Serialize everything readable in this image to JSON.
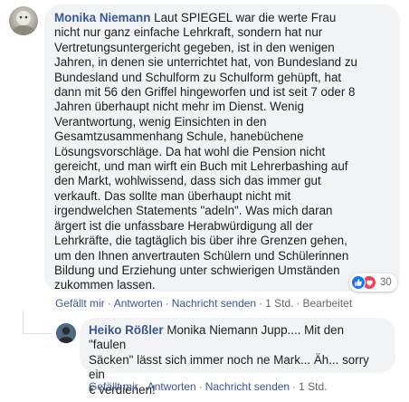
{
  "comment1": {
    "author": "Monika Niemann",
    "text": " Laut SPIEGEL war die werte Frau\nnicht nur ganz einfache Lehrkraft, sondern hat nur\nVertretungsuntergericht gegeben, ist in den wenigen\nJahren, in denen sie unterrichtet hat, von Bundesland zu\nBundesland und Schulform zu Schulform gehüpft, hat\ndann mit 56 den Griffel hingeworfen und ist seit 7 oder 8\nJahren überhaupt nicht mehr im Dienst. Wenig\nVerantwortung, wenig Einsichten in den\nGesamtzusammenhang Schule, hanebüchene\nLösungsvorschläge. Da hat wohl die Pension nicht\ngereicht, und man wirft ein Buch mit Lehrerbashing auf\nden Markt, wohlwissend, dass sich das immer gut\nverkauft. Das sollte man überhaupt nicht mit\nirgendwelchen Statements \"adeln\". Was mich daran\närgert ist die unfassbare Herabwürdigung all der\nLehrkräfte, die tagtäglich bis über ihre Grenzen gehen,\num den Ihnen anvertrauten Schülern und Schülerinnen\nBildung und Erziehung unter schwierigen Umständen\nzukommen lassen.",
    "reaction_count": "30",
    "reaction_icons": [
      "like-icon",
      "love-icon"
    ],
    "actions": {
      "like": "Gefällt mir",
      "reply": "Antworten",
      "message": "Nachricht senden",
      "time": "1 Std.",
      "edited": "Bearbeitet"
    }
  },
  "comment2": {
    "author": "Heiko Rößler",
    "text": " Monika Niemann Jupp.... Mit den \"faulen\nSäcken\" lässt sich immer noch ne Mark... Äh... sorry ein\n€ verdienen!",
    "actions": {
      "like": "Gefällt mir",
      "reply": "Antworten",
      "message": "Nachricht senden",
      "time": "1 Std."
    }
  },
  "colors": {
    "link": "#385898",
    "bubble": "#f2f3f5",
    "meta": "#606770",
    "like_blue": "#1877f2",
    "love_red": "#f33e58"
  }
}
